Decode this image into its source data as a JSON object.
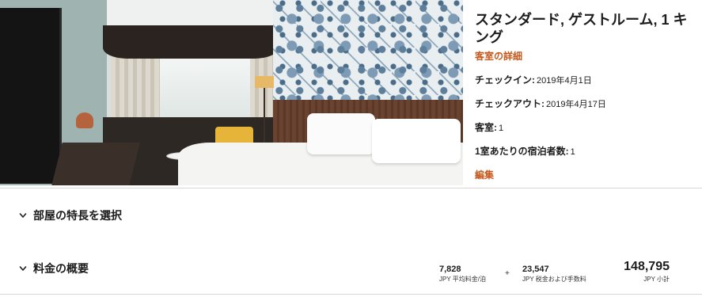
{
  "room": {
    "title": "スタンダード, ゲストルーム, 1 キング",
    "details_link": "客室の詳細",
    "checkin_label": "チェックイン:",
    "checkin_value": "2019年4月1日",
    "checkout_label": "チェックアウト:",
    "checkout_value": "2019年4月17日",
    "rooms_label": "客室:",
    "rooms_value": "1",
    "guests_label": "1室あたりの宿泊者数:",
    "guests_value": "1",
    "edit_link": "編集"
  },
  "sections": {
    "features_label": "部屋の特長を選択",
    "pricing_label": "料金の概要"
  },
  "pricing": {
    "avg_rate_value": "7,828",
    "avg_rate_label": "JPY 平均料金/泊",
    "plus_symbol": "+",
    "taxes_value": "23,547",
    "taxes_label": "JPY 税金および手数料",
    "subtotal_value": "148,795",
    "subtotal_label": "JPY 小計"
  },
  "colors": {
    "accent": "#c6581d",
    "text": "#1c1c1c",
    "divider": "#d6d6d6"
  },
  "icons": {
    "expand": "chevron-down-icon"
  }
}
